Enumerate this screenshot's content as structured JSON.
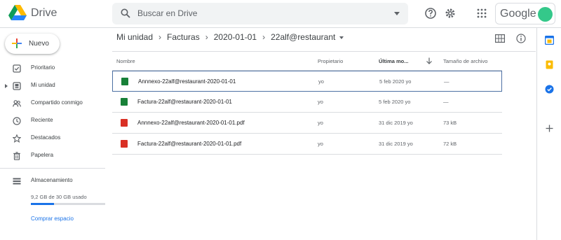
{
  "header": {
    "app_name": "Drive",
    "search_placeholder": "Buscar en Drive",
    "account_label": "Google"
  },
  "sidebar": {
    "new_label": "Nuevo",
    "items": [
      {
        "label": "Prioritario",
        "icon": "checkbox-icon"
      },
      {
        "label": "Mi unidad",
        "icon": "my-drive-icon"
      },
      {
        "label": "Compartido conmigo",
        "icon": "shared-icon"
      },
      {
        "label": "Reciente",
        "icon": "clock-icon"
      },
      {
        "label": "Destacados",
        "icon": "star-icon"
      },
      {
        "label": "Papelera",
        "icon": "trash-icon"
      }
    ],
    "storage": {
      "label": "Almacenamiento",
      "usage_text": "9,2 GB de 30 GB usado",
      "usage_fraction": 0.31,
      "buy_label": "Comprar espacio"
    }
  },
  "breadcrumb": [
    "Mi unidad",
    "Facturas",
    "2020-01-01",
    "22alf@restaurant"
  ],
  "table": {
    "columns": {
      "name": "Nombre",
      "owner": "Propietario",
      "modified": "Última mo...",
      "size": "Tamaño de archivo"
    },
    "rows": [
      {
        "name": "Annnexo-22alf@restaurant-2020-01-01",
        "type": "sheet",
        "owner": "yo",
        "modified": "5 feb 2020  yo",
        "size": "—",
        "selected": true
      },
      {
        "name": "Factura-22alf@restaurant-2020-01-01",
        "type": "sheet",
        "owner": "yo",
        "modified": "5 feb 2020  yo",
        "size": "—",
        "selected": false
      },
      {
        "name": "Annnexo-22alf@restaurant-2020-01-01.pdf",
        "type": "pdf",
        "owner": "yo",
        "modified": "31 dic 2019  yo",
        "size": "73 kB",
        "selected": false
      },
      {
        "name": "Factura-22alf@restaurant-2020-01-01.pdf",
        "type": "pdf",
        "owner": "yo",
        "modified": "31 dic 2019  yo",
        "size": "72 kB",
        "selected": false
      }
    ]
  },
  "colors": {
    "accent": "#1a73e8",
    "sheet": "#188038",
    "pdf": "#d93025"
  }
}
